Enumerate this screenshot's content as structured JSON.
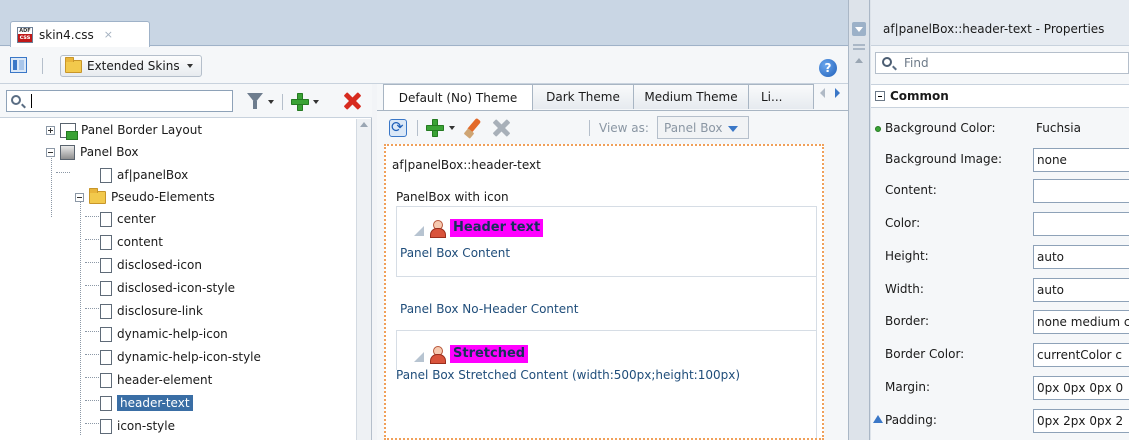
{
  "document_tab": {
    "title": "skin4.css",
    "icon": "css-file-icon",
    "close": "×",
    "icon_top": "ADF",
    "icon_bottom": "css"
  },
  "toolbar": {
    "extended_skins_label": "Extended Skins",
    "help_glyph": "?"
  },
  "tree_search": {
    "value": ""
  },
  "tree": {
    "items": [
      {
        "label": "Panel Border Layout",
        "level": 1,
        "expander": "plus",
        "icon": "layout-icon"
      },
      {
        "label": "Panel Box",
        "level": 1,
        "expander": "minus",
        "icon": "box-icon"
      },
      {
        "label": "af|panelBox",
        "level": 2,
        "expander": "none",
        "icon": "page-icon"
      },
      {
        "label": "Pseudo-Elements",
        "level": 2,
        "expander": "minus",
        "icon": "folder-icon"
      },
      {
        "label": "center",
        "level": 3,
        "icon": "page-icon"
      },
      {
        "label": "content",
        "level": 3,
        "icon": "page-icon"
      },
      {
        "label": "disclosed-icon",
        "level": 3,
        "icon": "page-icon"
      },
      {
        "label": "disclosed-icon-style",
        "level": 3,
        "icon": "page-icon"
      },
      {
        "label": "disclosure-link",
        "level": 3,
        "icon": "page-icon"
      },
      {
        "label": "dynamic-help-icon",
        "level": 3,
        "icon": "page-icon"
      },
      {
        "label": "dynamic-help-icon-style",
        "level": 3,
        "icon": "page-icon"
      },
      {
        "label": "header-element",
        "level": 3,
        "icon": "page-icon"
      },
      {
        "label": "header-text",
        "level": 3,
        "icon": "page-icon",
        "selected": true
      },
      {
        "label": "icon-style",
        "level": 3,
        "icon": "page-icon"
      }
    ]
  },
  "theme_tabs": [
    {
      "label": "Default (No) Theme",
      "active": true
    },
    {
      "label": "Dark Theme",
      "active": false
    },
    {
      "label": "Medium Theme",
      "active": false
    },
    {
      "label": "Li...",
      "active": false
    }
  ],
  "preview_toolbar": {
    "view_as_label": "View as:",
    "view_as_value": "Panel Box"
  },
  "preview": {
    "selector": "af|panelBox::header-text",
    "panel_with_icon_label": "PanelBox with icon",
    "header_text": "Header text",
    "content_1": "Panel Box Content",
    "no_header_content": "Panel Box No-Header Content",
    "stretched_header": "Stretched",
    "stretched_content": "Panel Box Stretched Content (width:500px;height:100px)",
    "highlight_color": "#ff00ff"
  },
  "properties": {
    "title": "af|panelBox::header-text - Properties",
    "find_placeholder": "Find",
    "section": "Common",
    "rows": [
      {
        "label": "Background Color:",
        "value": "Fuchsia",
        "marker": "dot",
        "plain": true
      },
      {
        "label": "Background Image:",
        "value": "none"
      },
      {
        "label": "Content:",
        "value": ""
      },
      {
        "label": "Color:",
        "value": ""
      },
      {
        "label": "Height:",
        "value": "auto"
      },
      {
        "label": "Width:",
        "value": "auto"
      },
      {
        "label": "Border:",
        "value": "none medium c"
      },
      {
        "label": "Border Color:",
        "value": "currentColor c"
      },
      {
        "label": "Margin:",
        "value": "0px 0px 0px 0"
      },
      {
        "label": "Padding:",
        "value": "0px 2px 0px 2",
        "marker": "arrow"
      }
    ]
  },
  "colors": {
    "accent": "#3a6ea5",
    "add": "#3aa335",
    "delete": "#d72b1f"
  }
}
